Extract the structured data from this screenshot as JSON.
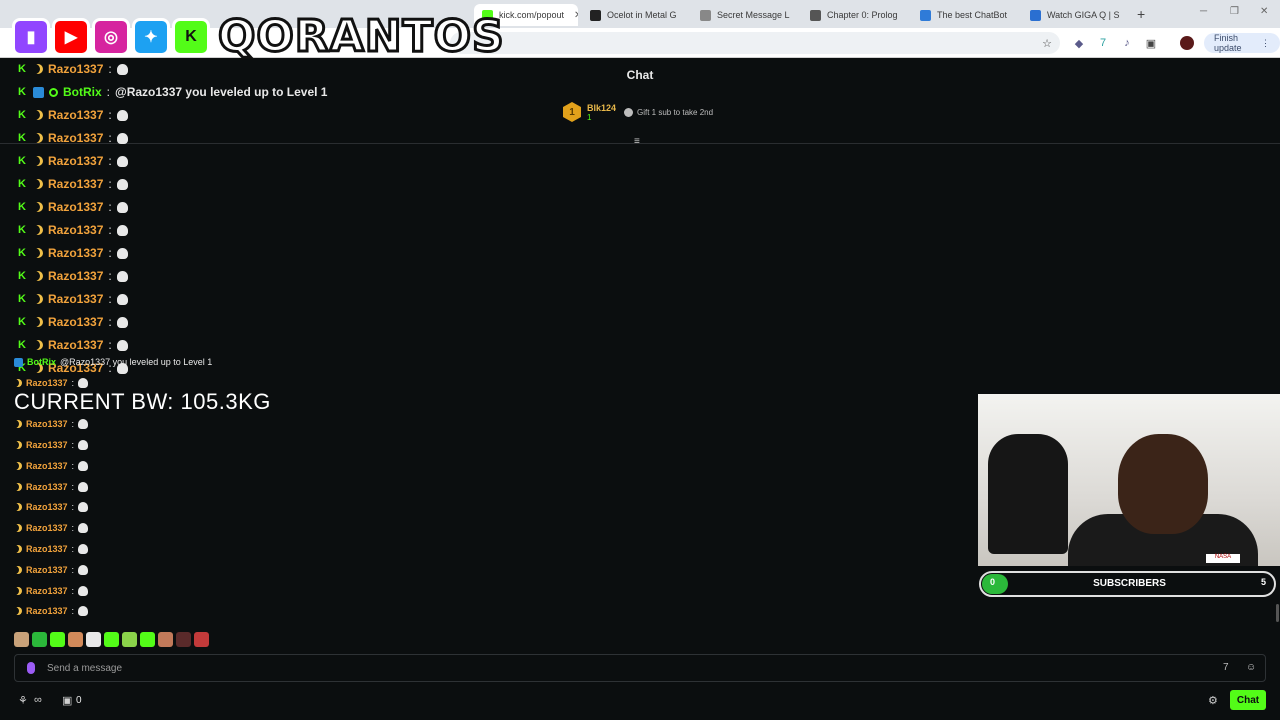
{
  "browser": {
    "tabs": [
      {
        "title": "kick.com/popout",
        "fav": "#53fc18",
        "active": true
      },
      {
        "title": "Ocelot in Metal G",
        "fav": "#222222",
        "active": false
      },
      {
        "title": "Secret Message L",
        "fav": "#888888",
        "active": false
      },
      {
        "title": "Chapter 0: Prolog",
        "fav": "#555555",
        "active": false
      },
      {
        "title": "The best ChatBot",
        "fav": "#2f7bd8",
        "active": false
      },
      {
        "title": "Watch GIGA Q | S",
        "fav": "#2a6fd1",
        "active": false
      }
    ],
    "finish_update": "Finish update"
  },
  "overlay": {
    "brand": "QORANTOS",
    "bodyweight": "CURRENT BW: 105.3KG"
  },
  "chat": {
    "title": "Chat",
    "pinned": {
      "medal": "1",
      "name": "Blk124",
      "count": "1",
      "gift_text": "Gift 1 sub to take 2nd"
    },
    "rows": [
      {
        "type": "user",
        "name": "Razo1337",
        "msg": "💀"
      },
      {
        "type": "bot",
        "name": "BotRix",
        "msg": "@Razo1337 you leveled up to Level 1"
      },
      {
        "type": "user",
        "name": "Razo1337",
        "msg": "💀"
      },
      {
        "type": "user",
        "name": "Razo1337",
        "msg": "💀"
      },
      {
        "type": "user",
        "name": "Razo1337",
        "msg": "💀"
      },
      {
        "type": "user",
        "name": "Razo1337",
        "msg": "💀"
      },
      {
        "type": "user",
        "name": "Razo1337",
        "msg": "💀"
      },
      {
        "type": "user",
        "name": "Razo1337",
        "msg": "💀"
      },
      {
        "type": "user",
        "name": "Razo1337",
        "msg": "💀"
      },
      {
        "type": "user",
        "name": "Razo1337",
        "msg": "💀"
      },
      {
        "type": "user",
        "name": "Razo1337",
        "msg": "💀"
      },
      {
        "type": "user",
        "name": "Razo1337",
        "msg": "💀"
      },
      {
        "type": "user",
        "name": "Razo1337",
        "msg": "💀"
      },
      {
        "type": "user",
        "name": "Razo1337",
        "msg": "💀"
      }
    ],
    "overlay_rows": [
      {
        "type": "bot",
        "name": "BotRix",
        "msg": "@Razo1337 you leveled up to Level 1"
      },
      {
        "type": "user",
        "name": "Razo1337",
        "msg": ""
      },
      {
        "type": "user",
        "name": "Razo1337",
        "msg": ""
      },
      {
        "type": "user",
        "name": "Razo1337",
        "msg": ""
      },
      {
        "type": "user",
        "name": "Razo1337",
        "msg": ""
      },
      {
        "type": "user",
        "name": "Razo1337",
        "msg": ""
      },
      {
        "type": "user",
        "name": "Razo1337",
        "msg": ""
      },
      {
        "type": "user",
        "name": "Razo1337",
        "msg": ""
      },
      {
        "type": "user",
        "name": "Razo1337",
        "msg": ""
      },
      {
        "type": "user",
        "name": "Razo1337",
        "msg": ""
      },
      {
        "type": "user",
        "name": "Razo1337",
        "msg": ""
      },
      {
        "type": "user",
        "name": "Razo1337",
        "msg": ""
      }
    ],
    "input_placeholder": "Send a message",
    "points": "0",
    "chat_button": "Chat"
  },
  "subgoal": {
    "start": "0",
    "label": "SUBSCRIBERS",
    "end": "5",
    "current": 0,
    "goal": 5
  },
  "colors": {
    "kick_green": "#53fc18",
    "username": "#f2a33c",
    "brand_purple": "#9b5cf5"
  },
  "emotes": [
    "#c9a27a",
    "#2bb83a",
    "#53fc18",
    "#d28a5a",
    "#e8e8e8",
    "#53fc18",
    "#8bd34a",
    "#53fc18",
    "#c27a5a",
    "#5a2a2a",
    "#c23a3a"
  ]
}
